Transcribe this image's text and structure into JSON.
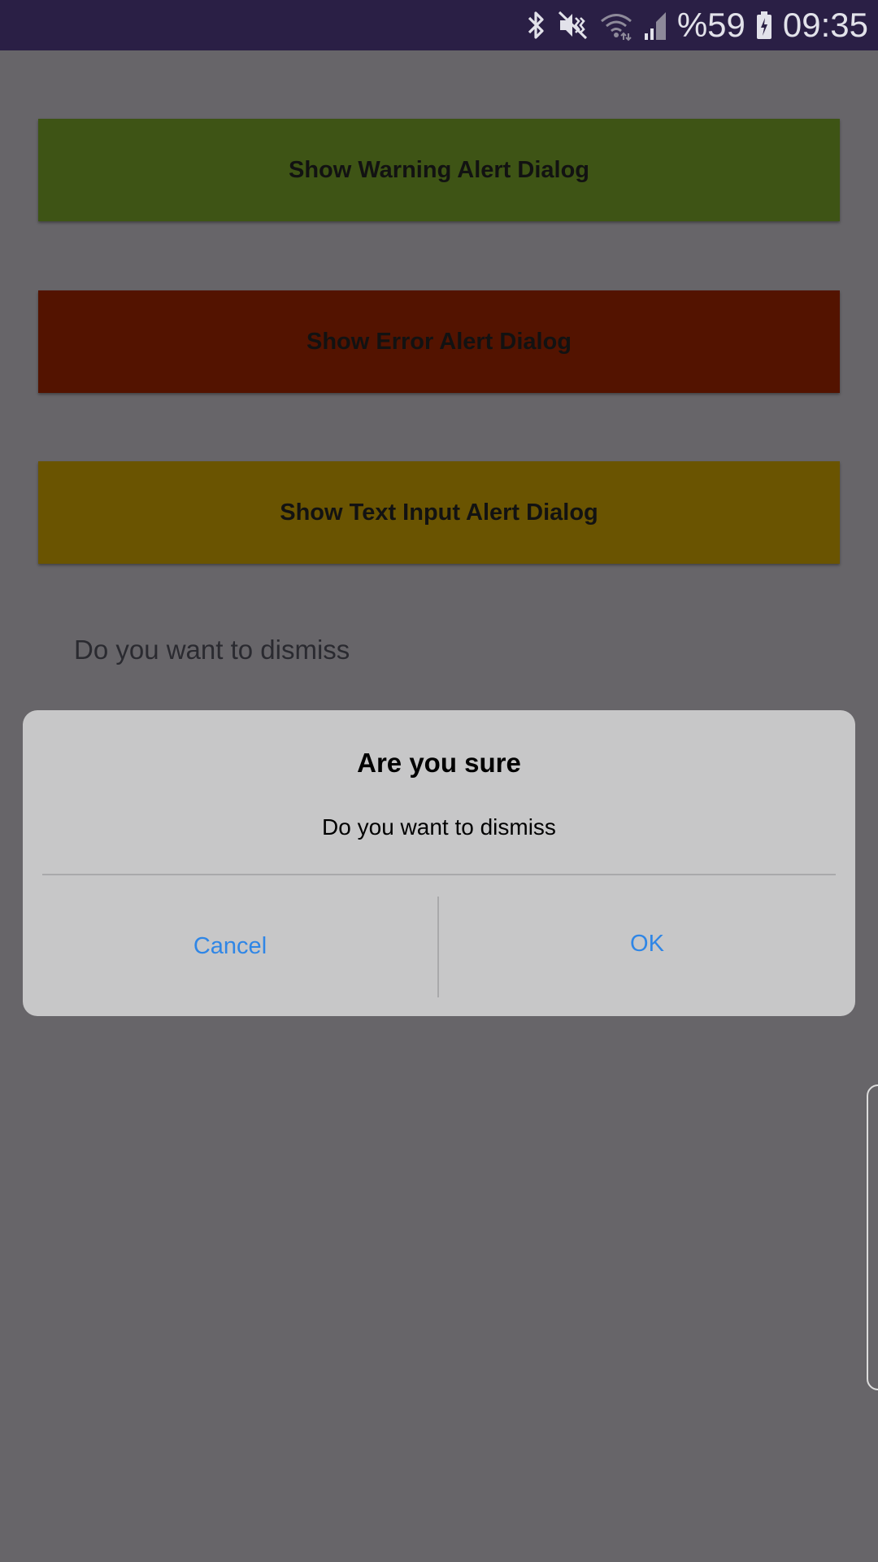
{
  "status_bar": {
    "battery_percent": "%59",
    "time": "09:35",
    "icons": [
      "bluetooth-icon",
      "mute-icon",
      "wifi-icon",
      "signal-icon",
      "battery-charging-icon"
    ],
    "background": "#2a1f45"
  },
  "buttons": {
    "warning_label": "Show Warning Alert Dialog",
    "error_label": "Show Error Alert Dialog",
    "text_input_label": "Show Text Input Alert Dialog",
    "warning_color": "#3e5415",
    "error_color": "#531300",
    "text_input_color": "#6a5401"
  },
  "result_text": "Do you want to dismiss",
  "dialog": {
    "title": "Are you sure",
    "message": "Do you want to dismiss",
    "cancel_label": "Cancel",
    "ok_label": "OK",
    "button_color": "#2f86e6"
  }
}
